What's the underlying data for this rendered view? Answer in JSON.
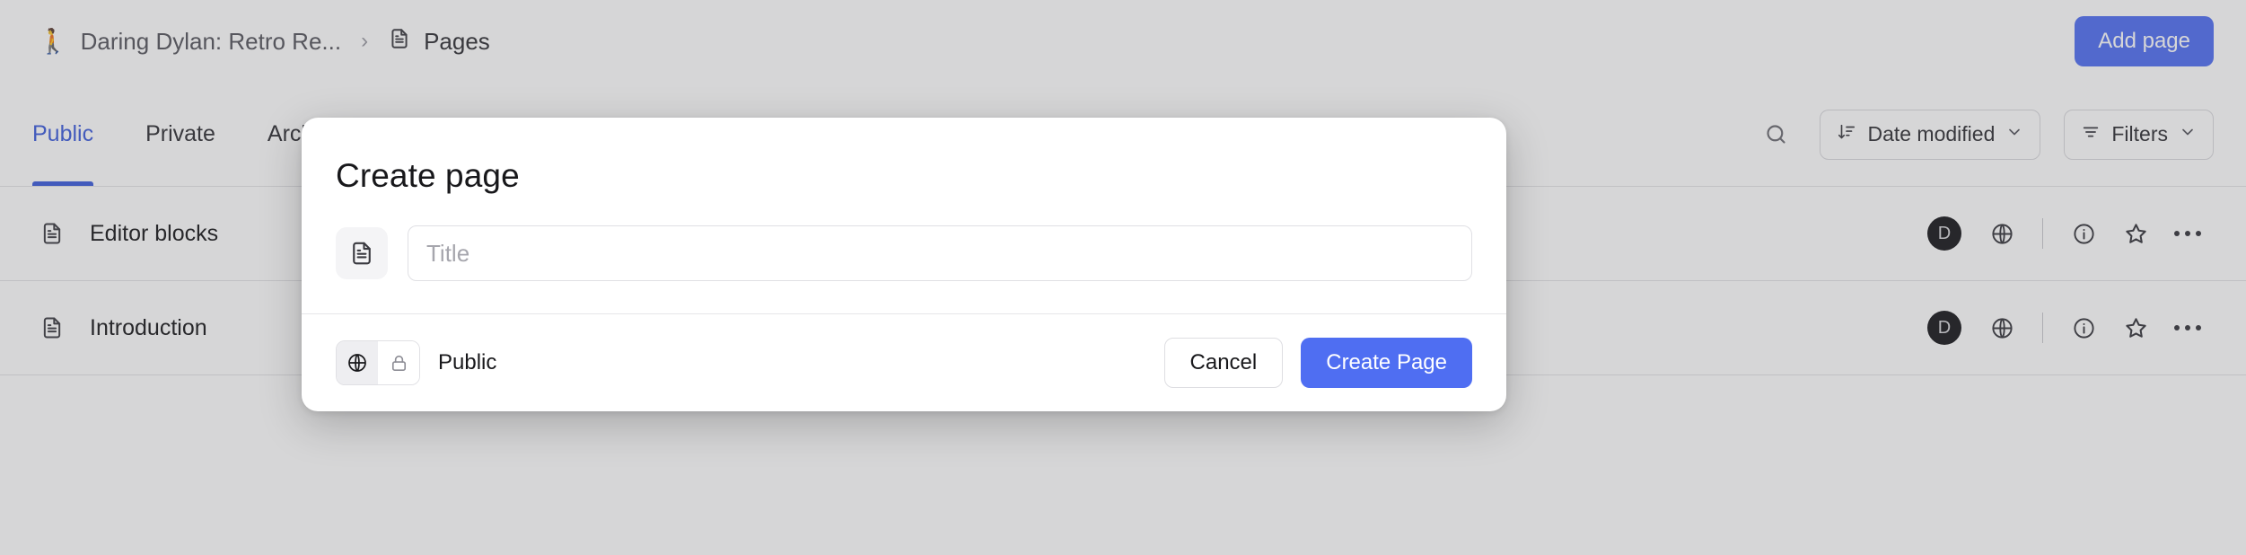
{
  "header": {
    "breadcrumb": {
      "emoji": "🚶",
      "project_label": "Daring Dylan: Retro Re...",
      "separator": "›",
      "current_label": "Pages"
    },
    "add_page_label": "Add page"
  },
  "tabs": [
    {
      "label": "Public",
      "active": true
    },
    {
      "label": "Private",
      "active": false
    },
    {
      "label": "Archived",
      "active": false
    }
  ],
  "toolbar": {
    "search_icon": "search-icon",
    "sort": {
      "label": "Date modified",
      "icon": "sort-descending-icon",
      "chevron": "chevron-down-icon"
    },
    "filters": {
      "label": "Filters",
      "icon": "filter-icon",
      "chevron": "chevron-down-icon"
    }
  },
  "pages": [
    {
      "title": "Editor blocks",
      "icon": "document-icon",
      "avatar_initial": "D",
      "visibility_icon": "globe-icon",
      "info_icon": "info-circle-icon",
      "star_icon": "star-outline-icon",
      "more_icon": "more-horizontal-icon"
    },
    {
      "title": "Introduction",
      "icon": "document-icon",
      "avatar_initial": "D",
      "visibility_icon": "globe-icon",
      "info_icon": "info-circle-icon",
      "star_icon": "star-outline-icon",
      "more_icon": "more-horizontal-icon"
    }
  ],
  "modal": {
    "title": "Create page",
    "icon_picker_icon": "document-icon",
    "title_input": {
      "value": "",
      "placeholder": "Title"
    },
    "visibility": {
      "public_icon": "globe-icon",
      "private_icon": "lock-icon",
      "selected": "public",
      "label": "Public"
    },
    "cancel_label": "Cancel",
    "create_label": "Create Page"
  },
  "colors": {
    "accent_blue": "#4f6ef2",
    "tab_active_blue": "#3b5bdb",
    "avatar_dark": "#16161a",
    "border": "#e3e3e6"
  }
}
